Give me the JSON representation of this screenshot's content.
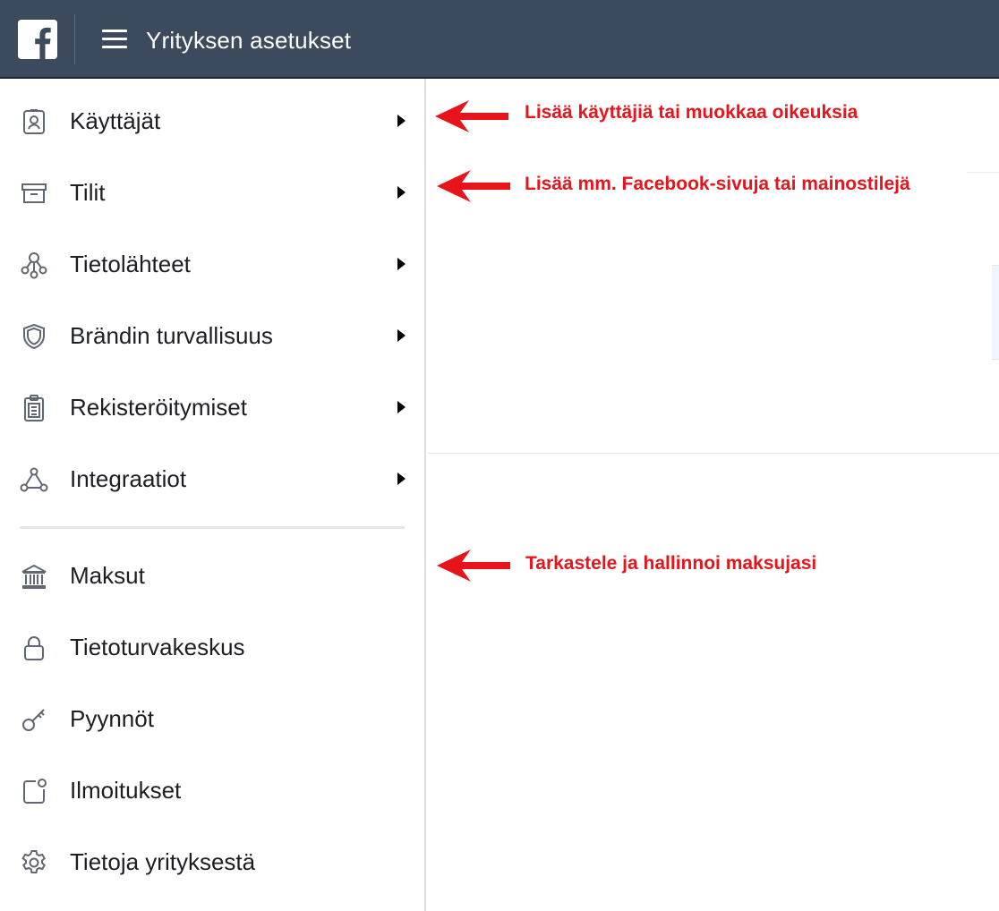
{
  "header": {
    "title": "Yrityksen asetukset",
    "logo_icon": "facebook-logo-icon",
    "menu_icon": "hamburger-menu-icon",
    "background_color": "#3b4a5c"
  },
  "sidebar": {
    "items": [
      {
        "label": "Käyttäjät",
        "icon": "user-badge-icon",
        "has_submenu": true
      },
      {
        "label": "Tilit",
        "icon": "archive-box-icon",
        "has_submenu": true
      },
      {
        "label": "Tietolähteet",
        "icon": "data-sources-icon",
        "has_submenu": true
      },
      {
        "label": "Brändin turvallisuus",
        "icon": "shield-icon",
        "has_submenu": true
      },
      {
        "label": "Rekisteröitymiset",
        "icon": "clipboard-icon",
        "has_submenu": true
      },
      {
        "label": "Integraatiot",
        "icon": "integration-nodes-icon",
        "has_submenu": true
      },
      {
        "label": "Maksut",
        "icon": "bank-icon",
        "has_submenu": false
      },
      {
        "label": "Tietoturvakeskus",
        "icon": "lock-icon",
        "has_submenu": false
      },
      {
        "label": "Pyynnöt",
        "icon": "key-icon",
        "has_submenu": false
      },
      {
        "label": "Ilmoitukset",
        "icon": "notification-icon",
        "has_submenu": false
      },
      {
        "label": "Tietoja yrityksestä",
        "icon": "gear-icon",
        "has_submenu": false
      }
    ]
  },
  "annotations": {
    "color": "#e8141b",
    "items": [
      {
        "text": "Lisää käyttäjiä tai muokkaa oikeuksia"
      },
      {
        "text": "Lisää mm. Facebook-sivuja tai mainostilejä"
      },
      {
        "text": "Tarkastele ja hallinnoi maksujasi"
      }
    ]
  }
}
